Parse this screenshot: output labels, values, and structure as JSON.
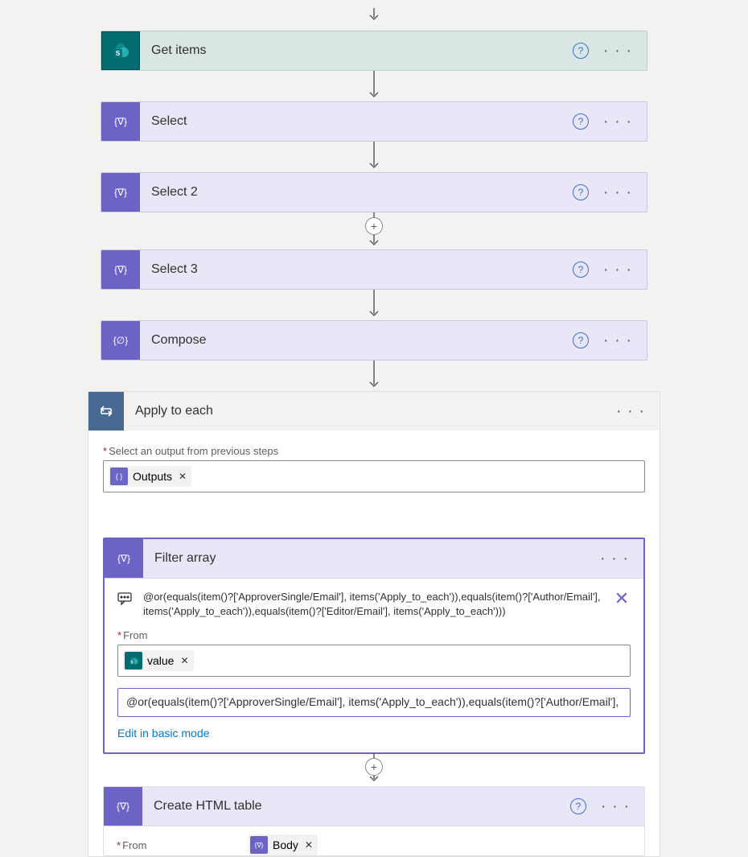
{
  "steps": {
    "get_items": {
      "label": "Get items"
    },
    "select": {
      "label": "Select"
    },
    "select2": {
      "label": "Select 2"
    },
    "select3": {
      "label": "Select 3"
    },
    "compose": {
      "label": "Compose"
    },
    "apply_to_each": {
      "label": "Apply to each",
      "output_label": "Select an output from previous steps",
      "output_token": "Outputs"
    },
    "filter_array": {
      "label": "Filter array",
      "expression": "@or(equals(item()?['ApproverSingle/Email'], items('Apply_to_each')),equals(item()?['Author/Email'], items('Apply_to_each')),equals(item()?['Editor/Email'], items('Apply_to_each')))",
      "from_label": "From",
      "from_token": "value",
      "code_input": "@or(equals(item()?['ApproverSingle/Email'], items('Apply_to_each')),equals(item()?['Author/Email'],",
      "basic_mode_link": "Edit in basic mode"
    },
    "create_html_table": {
      "label": "Create HTML table",
      "from_label": "From",
      "from_token": "Body"
    }
  },
  "ui": {
    "required_marker": "*",
    "remove_x": "✕"
  }
}
